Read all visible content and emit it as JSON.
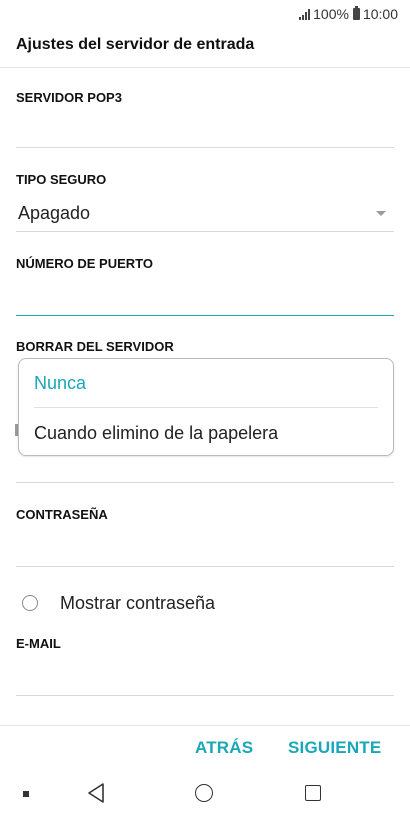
{
  "status_bar": {
    "battery_percent": "100%",
    "time": "10:00",
    "icons": [
      "signal-icon",
      "battery-icon"
    ]
  },
  "header": {
    "title": "Ajustes del servidor de entrada"
  },
  "form": {
    "pop3_server_label": "SERVIDOR POP3",
    "pop3_server_value": "",
    "secure_type_label": "TIPO SEGURO",
    "secure_type_value": "Apagado",
    "port_label": "NÚMERO DE PUERTO",
    "port_value": "",
    "delete_from_server_label": "BORRAR DEL SERVIDOR",
    "delete_options": [
      "Nunca",
      "Cuando elimino de la papelera"
    ],
    "delete_selected": "Nunca",
    "password_label": "CONTRASEÑA",
    "password_value": "",
    "show_password_label": "Mostrar contraseña",
    "show_password_checked": false,
    "email_label": "E-MAIL",
    "email_value": ""
  },
  "actions": {
    "back_label": "ATRÁS",
    "next_label": "SIGUIENTE"
  },
  "nav_bar": {
    "icons": [
      "square-dot-icon",
      "back-triangle-icon",
      "home-circle-icon",
      "recent-apps-square-icon"
    ]
  },
  "colors": {
    "accent": "#1aa7b8",
    "text": "#222222",
    "divider": "#d9d9d9"
  }
}
